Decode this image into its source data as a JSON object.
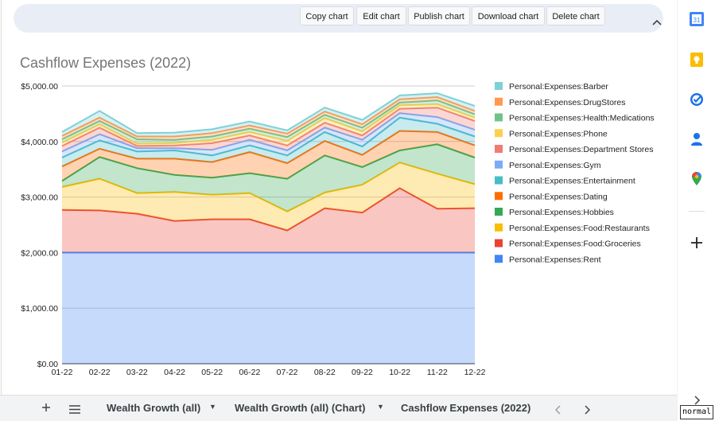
{
  "toolbar": {
    "buttons": [
      {
        "label": "Copy chart"
      },
      {
        "label": "Edit chart"
      },
      {
        "label": "Publish chart"
      },
      {
        "label": "Download chart"
      },
      {
        "label": "Delete chart"
      }
    ],
    "collapse_icon": "chevron-up-icon"
  },
  "chart_data": {
    "type": "area",
    "stacked": true,
    "title": "Cashflow Expenses (2022)",
    "xlabel": "",
    "ylabel": "",
    "categories": [
      "01-22",
      "02-22",
      "03-22",
      "04-22",
      "05-22",
      "06-22",
      "07-22",
      "08-22",
      "09-22",
      "10-22",
      "11-22",
      "12-22"
    ],
    "ylim": [
      0,
      5000
    ],
    "y_ticks": [
      "$0.00",
      "$1,000.00",
      "$2,000.00",
      "$3,000.00",
      "$4,000.00",
      "$5,000.00"
    ],
    "grid": true,
    "legend_position": "right",
    "series": [
      {
        "name": "Personal:Expenses:Rent",
        "color": "#4285f4",
        "values": [
          2000,
          2000,
          2000,
          2000,
          2000,
          2000,
          2000,
          2000,
          2000,
          2000,
          2000,
          2000
        ]
      },
      {
        "name": "Personal:Expenses:Food:Groceries",
        "color": "#ea4335",
        "values": [
          770,
          760,
          700,
          570,
          600,
          600,
          400,
          800,
          720,
          1160,
          790,
          800
        ]
      },
      {
        "name": "Personal:Expenses:Food:Restaurants",
        "color": "#fbbc04",
        "values": [
          410,
          570,
          370,
          520,
          440,
          470,
          340,
          280,
          500,
          460,
          630,
          430
        ]
      },
      {
        "name": "Personal:Expenses:Hobbies",
        "color": "#34a853",
        "values": [
          110,
          390,
          450,
          310,
          310,
          360,
          590,
          670,
          320,
          220,
          530,
          480
        ]
      },
      {
        "name": "Personal:Expenses:Dating",
        "color": "#ff6d01",
        "values": [
          260,
          150,
          170,
          290,
          280,
          380,
          280,
          260,
          220,
          350,
          220,
          220
        ]
      },
      {
        "name": "Personal:Expenses:Entertainment",
        "color": "#46bdc6",
        "values": [
          160,
          150,
          130,
          150,
          120,
          120,
          140,
          160,
          150,
          240,
          150,
          160
        ]
      },
      {
        "name": "Personal:Expenses:Gym",
        "color": "#7baaf7",
        "values": [
          110,
          110,
          60,
          40,
          100,
          100,
          90,
          80,
          120,
          80,
          120,
          120
        ]
      },
      {
        "name": "Personal:Expenses:Department Stores",
        "color": "#f07b72",
        "values": [
          100,
          120,
          40,
          50,
          120,
          80,
          90,
          90,
          80,
          80,
          170,
          160
        ]
      },
      {
        "name": "Personal:Expenses:Phone",
        "color": "#fcd04f",
        "values": [
          60,
          60,
          40,
          40,
          60,
          60,
          80,
          80,
          70,
          60,
          60,
          60
        ]
      },
      {
        "name": "Personal:Expenses:Health:Medications",
        "color": "#71c287",
        "values": [
          60,
          60,
          80,
          60,
          60,
          60,
          70,
          60,
          70,
          50,
          70,
          60
        ]
      },
      {
        "name": "Personal:Expenses:DrugStores",
        "color": "#ff994d",
        "values": [
          60,
          60,
          50,
          60,
          60,
          60,
          60,
          60,
          60,
          60,
          60,
          60
        ]
      },
      {
        "name": "Personal:Expenses:Barber",
        "color": "#7ed1d7",
        "values": [
          70,
          120,
          60,
          70,
          70,
          70,
          60,
          70,
          80,
          70,
          70,
          90
        ]
      }
    ]
  },
  "tabs": [
    {
      "label": "Wealth Growth (all)"
    },
    {
      "label": "Wealth Growth (all) (Chart)"
    },
    {
      "label": "Cashflow Expenses (2022)"
    }
  ],
  "tabbar": {
    "add_icon": "plus-icon",
    "menu_icon": "hamburger-menu-icon",
    "prev_icon": "chevron-left-icon",
    "next_icon": "chevron-right-icon"
  },
  "side_panel": {
    "icons": [
      "google-calendar-icon",
      "google-keep-icon",
      "google-tasks-icon",
      "google-contacts-icon",
      "google-maps-icon",
      "add-plus-icon",
      "expand-chevron-icon"
    ]
  },
  "mode_badge": "normal"
}
